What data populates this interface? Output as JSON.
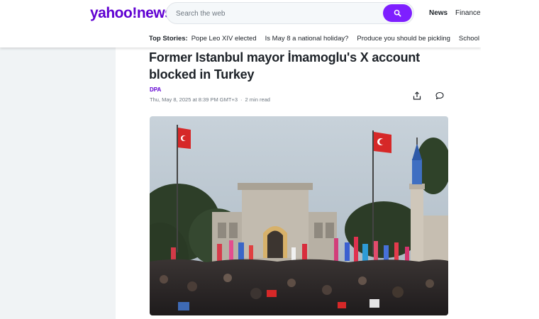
{
  "header": {
    "logo_text": "yahoo!news",
    "search_placeholder": "Search the web",
    "nav": {
      "news": "News",
      "finance": "Finance"
    }
  },
  "top_stories": {
    "label": "Top Stories:",
    "items": [
      "Pope Leo XIV elected",
      "Is May 8 a national holiday?",
      "Produce you should be pickling",
      "School vouche"
    ]
  },
  "article": {
    "title": "Former Istanbul mayor İmamoglu's X account blocked in Turkey",
    "author": "DPA",
    "date": "Thu, May 8, 2025 at 8:39 PM GMT+3",
    "read_time": "2 min read"
  },
  "icons": {
    "search": "search-icon",
    "share": "share-icon",
    "comment": "comment-icon"
  },
  "colors": {
    "brand": "#6001d2",
    "search_button": "#7e1fff",
    "flag_red": "#d62828"
  }
}
